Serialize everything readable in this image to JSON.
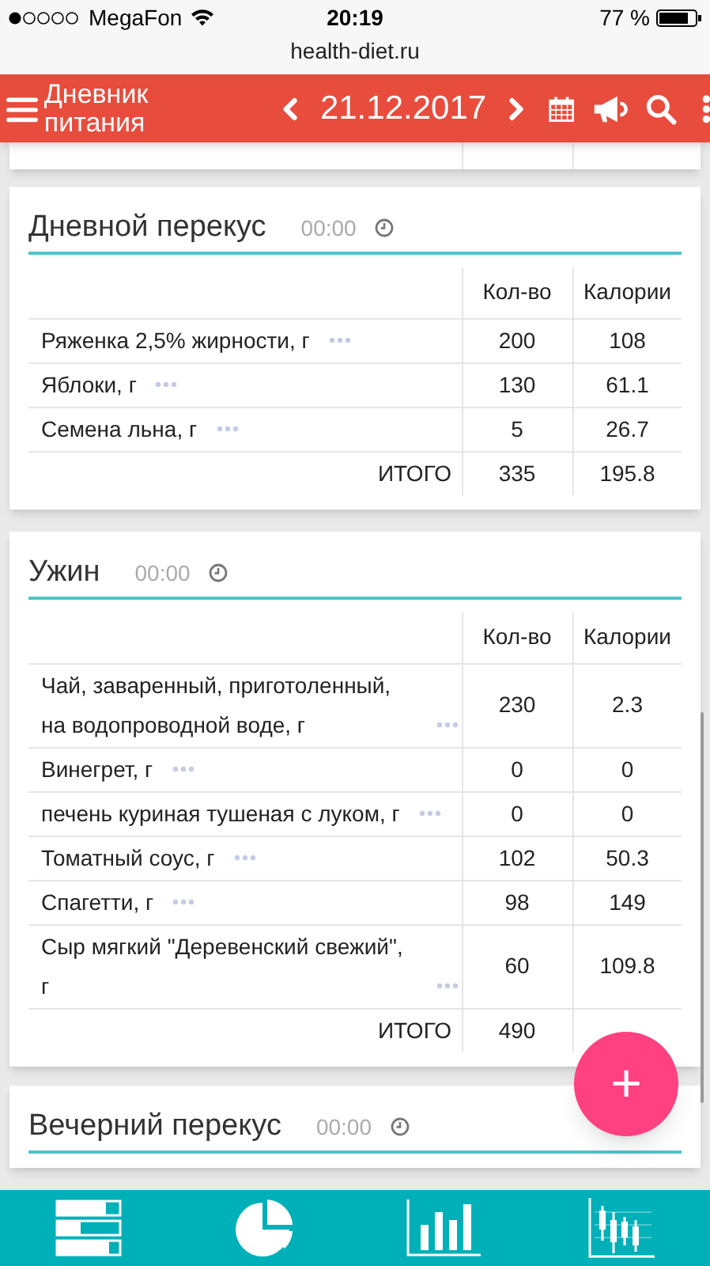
{
  "status_bar": {
    "carrier": "MegaFon",
    "time": "20:19",
    "battery": "77 %"
  },
  "url": "health-diet.ru",
  "header": {
    "title": "Дневник питания",
    "date": "21.12.2017"
  },
  "meals": [
    {
      "title": "Дневной перекус",
      "time": "00:00",
      "columns": [
        "Кол-во",
        "Калории"
      ],
      "rows": [
        {
          "name": "Ряженка 2,5% жирности, г",
          "qty": "200",
          "calories": "108"
        },
        {
          "name": "Яблоки, г",
          "qty": "130",
          "calories": "61.1"
        },
        {
          "name": "Семена льна, г",
          "qty": "5",
          "calories": "26.7"
        }
      ],
      "total": {
        "label": "ИТОГО",
        "qty": "335",
        "calories": "195.8"
      }
    },
    {
      "title": "Ужин",
      "time": "00:00",
      "columns": [
        "Кол-во",
        "Калории"
      ],
      "rows": [
        {
          "name": "Чай, заваренный, приготоленный, на водопроводной воде, г",
          "qty": "230",
          "calories": "2.3"
        },
        {
          "name": "Винегрет, г",
          "qty": "0",
          "calories": "0"
        },
        {
          "name": "печень куриная тушеная с луком, г",
          "qty": "0",
          "calories": "0"
        },
        {
          "name": "Томатный соус, г",
          "qty": "102",
          "calories": "50.3"
        },
        {
          "name": "Спагетти, г",
          "qty": "98",
          "calories": "149"
        },
        {
          "name": "Сыр мягкий \"Деревенский свежий\", г",
          "qty": "60",
          "calories": "109.8"
        }
      ],
      "total": {
        "label": "ИТОГО",
        "qty": "490"
      }
    },
    {
      "title": "Вечерний перекус",
      "time": "00:00"
    }
  ],
  "fab": "+"
}
